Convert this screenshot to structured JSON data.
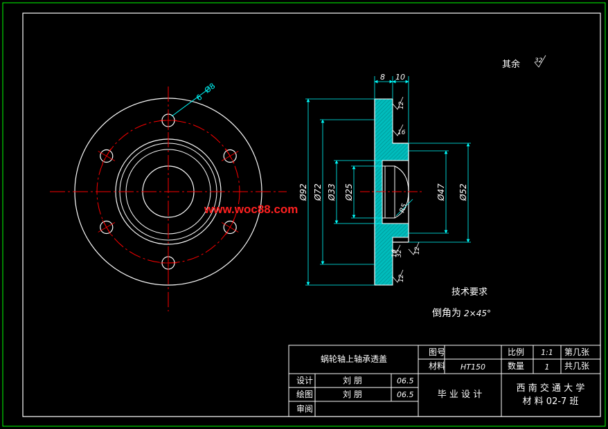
{
  "colors": {
    "background": "#000000",
    "frame": "#00ff00",
    "outline": "#ffffff",
    "centerline": "#ff0000",
    "dimension": "#00ffff",
    "section_fill": "#00ffff",
    "text": "#ffffff",
    "watermark": "#ff2020"
  },
  "front_view": {
    "hole_callout_count": "6",
    "hole_callout_dia": "Ø8"
  },
  "section_view": {
    "dims_vertical": [
      "Ø92",
      "Ø72",
      "Ø33",
      "Ø25"
    ],
    "dims_right": [
      "Ø47",
      "Ø52"
    ],
    "dims_top": [
      "8",
      "10"
    ],
    "radius": "R5",
    "roughness_values": [
      "12",
      "12",
      "12",
      "16",
      "32",
      "16"
    ]
  },
  "other_roughness": {
    "label": "其余",
    "value": "32"
  },
  "watermark": "www.woc88.com",
  "tech_requirements": {
    "title": "技术要求",
    "chamfer_label": "倒角为",
    "chamfer_value": "2×45°"
  },
  "title_block": {
    "part_name": "蜗轮轴上轴承透盖",
    "drawing_no_label": "图号",
    "drawing_no_value": "",
    "material_label": "材料",
    "material_value": "HT150",
    "scale_label": "比例",
    "scale_value": "1:1",
    "quantity_label": "数量",
    "quantity_value": "1",
    "sheet_no_label": "第几张",
    "total_sheets_label": "共几张",
    "design_label": "设计",
    "design_name": "刘 朋",
    "design_date": "06.5",
    "draw_label": "绘图",
    "draw_name": "刘 朋",
    "draw_date": "06.5",
    "review_label": "审阅",
    "project": "毕 业 设 计",
    "school": "西 南 交 通 大 学",
    "class_name": "材 料 02-7 班"
  }
}
